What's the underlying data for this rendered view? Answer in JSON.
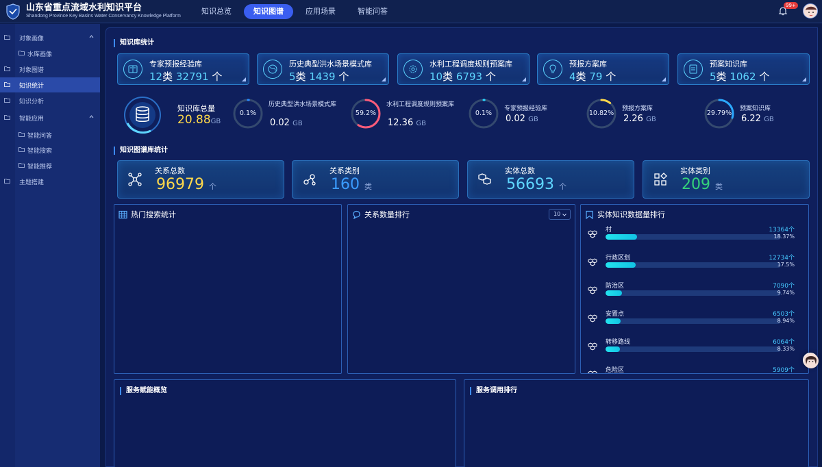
{
  "header": {
    "title_cn": "山东省重点流域水利知识平台",
    "title_en": "Shandong Province Key Basins Water Conservancy Knowledge Platform",
    "tabs": [
      {
        "label": "知识总览"
      },
      {
        "label": "知识图谱"
      },
      {
        "label": "应用场景"
      },
      {
        "label": "智能问答"
      }
    ],
    "notification_badge": "99+"
  },
  "sidebar": {
    "items": [
      {
        "label": "对象画像"
      },
      {
        "label": "水库画像"
      },
      {
        "label": "对象图谱"
      },
      {
        "label": "知识统计"
      },
      {
        "label": "知识分析"
      },
      {
        "label": "智能应用"
      },
      {
        "label": "智能问答"
      },
      {
        "label": "智能搜索"
      },
      {
        "label": "智能推荐"
      },
      {
        "label": "主题搭建"
      }
    ]
  },
  "kb_stats": {
    "title": "知识库统计",
    "cards": [
      {
        "name": "专家预报经验库",
        "cat": "12",
        "cat_unit": "类",
        "count": "32791",
        "count_unit": "个"
      },
      {
        "name": "历史典型洪水场景模式库",
        "cat": "5",
        "cat_unit": "类",
        "count": "1439",
        "count_unit": "个"
      },
      {
        "name": "水利工程调度规则预案库",
        "cat": "10",
        "cat_unit": "类",
        "count": "6793",
        "count_unit": "个"
      },
      {
        "name": "预报方案库",
        "cat": "4",
        "cat_unit": "类",
        "count": "79",
        "count_unit": "个"
      },
      {
        "name": "预案知识库",
        "cat": "5",
        "cat_unit": "类",
        "count": "1062",
        "count_unit": "个"
      }
    ],
    "total": {
      "label": "知识库总量",
      "value": "20.88",
      "unit": "GB"
    },
    "shares": [
      {
        "pct_label": "0.1%",
        "pct": 0.001,
        "name": "历史典型洪水场景模式库",
        "value": "0.02",
        "unit": "GB",
        "color": "#2a8bff"
      },
      {
        "pct_label": "59.2%",
        "pct": 0.592,
        "name": "水利工程调度规则预案库",
        "value": "12.36",
        "unit": "GB",
        "color": "#ff5b7a"
      },
      {
        "pct_label": "0.1%",
        "pct": 0.001,
        "name": "专家预报经验库",
        "value": "0.02",
        "unit": "GB",
        "color": "#2ad4ff"
      },
      {
        "pct_label": "10.82%",
        "pct": 0.1082,
        "name": "预报方案库",
        "value": "2.26",
        "unit": "GB",
        "color": "#ffd84a"
      },
      {
        "pct_label": "29.79%",
        "pct": 0.2979,
        "name": "预案知识库",
        "value": "6.22",
        "unit": "GB",
        "color": "#2aa8ff"
      }
    ]
  },
  "graph_stats": {
    "title": "知识图谱库统计",
    "cards": [
      {
        "label": "关系总数",
        "value": "96979",
        "unit": "个",
        "color": "#ffd84a"
      },
      {
        "label": "关系类别",
        "value": "160",
        "unit": "类",
        "color": "#3b9bff"
      },
      {
        "label": "实体总数",
        "value": "56693",
        "unit": "个",
        "color": "#5fd6ff"
      },
      {
        "label": "实体类别",
        "value": "209",
        "unit": "类",
        "color": "#34d27a"
      }
    ]
  },
  "panels": {
    "hot_search": {
      "title": "热门搜索统计"
    },
    "relation_rank": {
      "title": "关系数量排行",
      "select_value": "10"
    },
    "entity_rank": {
      "title": "实体知识数据量排行",
      "rows": [
        {
          "name": "村",
          "count": "13364个",
          "pct_label": "18.37%",
          "pct": 0.1837
        },
        {
          "name": "行政区划",
          "count": "12734个",
          "pct_label": "17.5%",
          "pct": 0.175
        },
        {
          "name": "防治区",
          "count": "7090个",
          "pct_label": "9.74%",
          "pct": 0.0974
        },
        {
          "name": "安置点",
          "count": "6503个",
          "pct_label": "8.94%",
          "pct": 0.0894
        },
        {
          "name": "转移路线",
          "count": "6064个",
          "pct_label": "8.33%",
          "pct": 0.0833
        },
        {
          "name": "危险区",
          "count": "5909个",
          "pct_label": "",
          "pct": 0.081
        }
      ]
    },
    "service_overview": {
      "title": "服务赋能概览"
    },
    "service_rank": {
      "title": "服务调用排行"
    }
  },
  "icons": {
    "logo": "shield-logo-icon",
    "bell": "bell-icon",
    "folder": "folder-icon",
    "relation": "network-icon",
    "entity": "cubes-icon"
  }
}
